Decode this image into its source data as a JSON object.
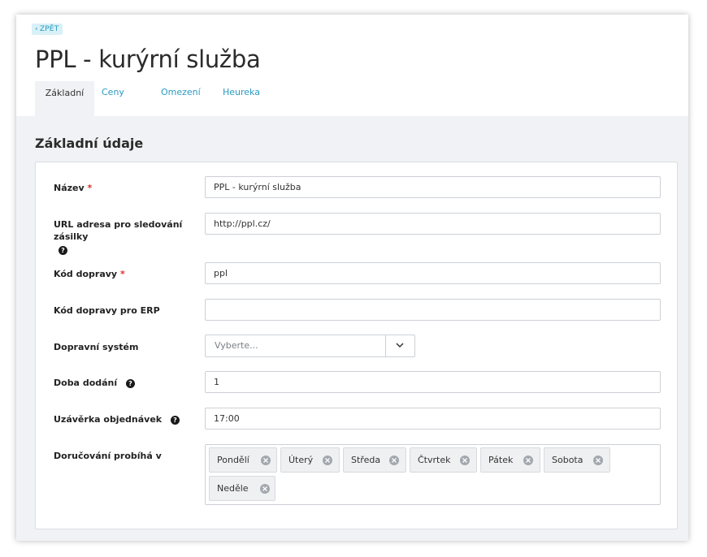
{
  "back": {
    "label": "ZPĚT"
  },
  "page": {
    "title": "PPL - kurýrní služba"
  },
  "tabs": [
    {
      "label": "Základní"
    },
    {
      "label": "Ceny"
    },
    {
      "label": "Omezení"
    },
    {
      "label": "Heureka"
    }
  ],
  "section": {
    "title": "Základní údaje"
  },
  "form": {
    "name": {
      "label": "Název",
      "required": "*",
      "value": "PPL - kurýrní služba"
    },
    "tracking_url": {
      "label": "URL adresa pro sledování zásilky",
      "value": "http://ppl.cz/"
    },
    "code": {
      "label": "Kód dopravy",
      "required": "*",
      "value": "ppl"
    },
    "erp_code": {
      "label": "Kód dopravy pro ERP",
      "value": ""
    },
    "system": {
      "label": "Dopravní systém",
      "placeholder": "Vyberte..."
    },
    "delivery_time": {
      "label": "Doba dodání",
      "value": "1"
    },
    "order_cutoff": {
      "label": "Uzávěrka objednávek",
      "value": "17:00"
    },
    "delivery_days": {
      "label": "Doručování probíhá v",
      "tags": [
        "Pondělí",
        "Úterý",
        "Středa",
        "Čtvrtek",
        "Pátek",
        "Sobota",
        "Neděle"
      ]
    }
  },
  "icons": {
    "help": "question-circle-icon",
    "remove": "remove-tag-icon",
    "chevron": "chevron-down-icon",
    "back": "chevron-left-icon"
  },
  "colors": {
    "accent": "#2a9ac0",
    "required": "#d9322b",
    "background": "#f0f2f5",
    "back_badge": "#d9f1f7"
  }
}
